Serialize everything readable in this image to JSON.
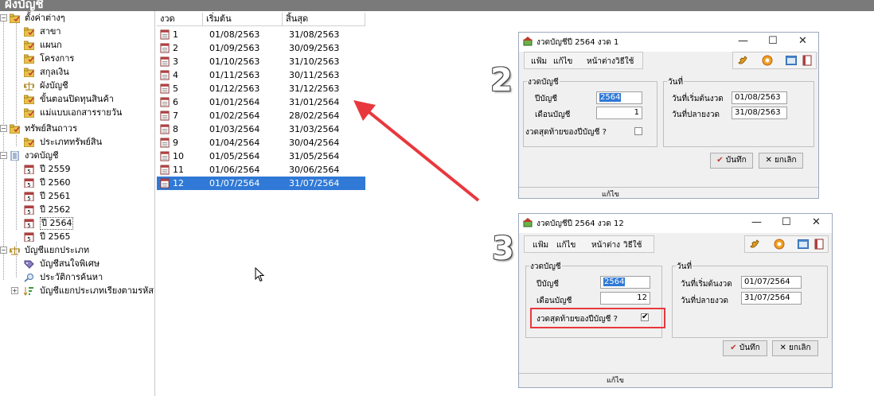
{
  "window_title": "ผังบัญชี",
  "tree": {
    "items": [
      {
        "label": "ตั้งค่าต่างๆ"
      },
      {
        "label": "สาขา"
      },
      {
        "label": "แผนก"
      },
      {
        "label": "โครงการ"
      },
      {
        "label": "สกุลเงิน"
      },
      {
        "label": "ผังบัญชี"
      },
      {
        "label": "ขั้นตอนปิดทุนสินค้า"
      },
      {
        "label": "แม่แบบเอกสารรายวัน"
      },
      {
        "label": "ทรัพย์สินถาวร"
      },
      {
        "label": "ประเภททรัพย์สิน"
      },
      {
        "label": "งวดบัญชี"
      },
      {
        "label": "ปี 2559"
      },
      {
        "label": "ปี 2560"
      },
      {
        "label": "ปี 2561"
      },
      {
        "label": "ปี 2562"
      },
      {
        "label": "ปี 2564"
      },
      {
        "label": "ปี 2565"
      },
      {
        "label": "บัญชีแยกประเภท"
      },
      {
        "label": "บัญชีสนใจพิเศษ"
      },
      {
        "label": "ประวัติการค้นหา"
      },
      {
        "label": "บัญชีแยกประเภทเรียงตามรหัส"
      }
    ]
  },
  "list": {
    "columns": [
      "งวด",
      "เริ่มต้น",
      "สิ้นสุด"
    ],
    "rows": [
      {
        "period": "1",
        "start": "01/08/2563",
        "end": "31/08/2563"
      },
      {
        "period": "2",
        "start": "01/09/2563",
        "end": "30/09/2563"
      },
      {
        "period": "3",
        "start": "01/10/2563",
        "end": "31/10/2563"
      },
      {
        "period": "4",
        "start": "01/11/2563",
        "end": "30/11/2563"
      },
      {
        "period": "5",
        "start": "01/12/2563",
        "end": "31/12/2563"
      },
      {
        "period": "6",
        "start": "01/01/2564",
        "end": "31/01/2564"
      },
      {
        "period": "7",
        "start": "01/02/2564",
        "end": "28/02/2564"
      },
      {
        "period": "8",
        "start": "01/03/2564",
        "end": "31/03/2564"
      },
      {
        "period": "9",
        "start": "01/04/2564",
        "end": "30/04/2564"
      },
      {
        "period": "10",
        "start": "01/05/2564",
        "end": "31/05/2564"
      },
      {
        "period": "11",
        "start": "01/06/2564",
        "end": "30/06/2564"
      },
      {
        "period": "12",
        "start": "01/07/2564",
        "end": "31/07/2564"
      }
    ],
    "selected_index": 11
  },
  "dialog1": {
    "marker": "2",
    "title": "งวดบัญชีปี 2564 งวด 1",
    "menu": [
      "แฟ้ม",
      "แก้ไข",
      "หน้าต่าง",
      "วิธีใช้"
    ],
    "group_period": "งวดบัญชี",
    "group_date": "วันที่",
    "lbl_year": "ปีบัญชี",
    "val_year": "2564",
    "lbl_month": "เดือนบัญชี",
    "val_month": "1",
    "lbl_last": "งวดสุดท้ายของปีบัญชี ?",
    "last_checked": false,
    "lbl_start": "วันที่เริ่มต้นงวด",
    "val_start": "01/08/2563",
    "lbl_end": "วันที่ปลายงวด",
    "val_end": "31/08/2563",
    "save": "บันทึก",
    "cancel": "ยกเลิก",
    "status": "แก้ไข"
  },
  "dialog2": {
    "marker": "3",
    "title": "งวดบัญชีปี 2564 งวด 12",
    "menu": [
      "แฟ้ม",
      "แก้ไข",
      "หน้าต่าง",
      "วิธีใช้"
    ],
    "group_period": "งวดบัญชี",
    "group_date": "วันที่",
    "lbl_year": "ปีบัญชี",
    "val_year": "2564",
    "lbl_month": "เดือนบัญชี",
    "val_month": "12",
    "lbl_last": "งวดสุดท้ายของปีบัญชี ?",
    "last_checked": true,
    "check_mark": "✔",
    "lbl_start": "วันที่เริ่มต้นงวด",
    "val_start": "01/07/2564",
    "lbl_end": "วันที่ปลายงวด",
    "val_end": "31/07/2564",
    "save": "บันทึก",
    "cancel": "ยกเลิก",
    "status": "แก้ไข"
  },
  "colors": {
    "selection": "#3079d6",
    "annotation_red": "#e8383d",
    "titlebar": "#7a7a7a",
    "folder_yellow": "#e8c14a"
  },
  "icons": {
    "close": "✕",
    "minimize": "—",
    "maximize": "☐",
    "save_check": "✔",
    "cancel_x": "✕"
  }
}
